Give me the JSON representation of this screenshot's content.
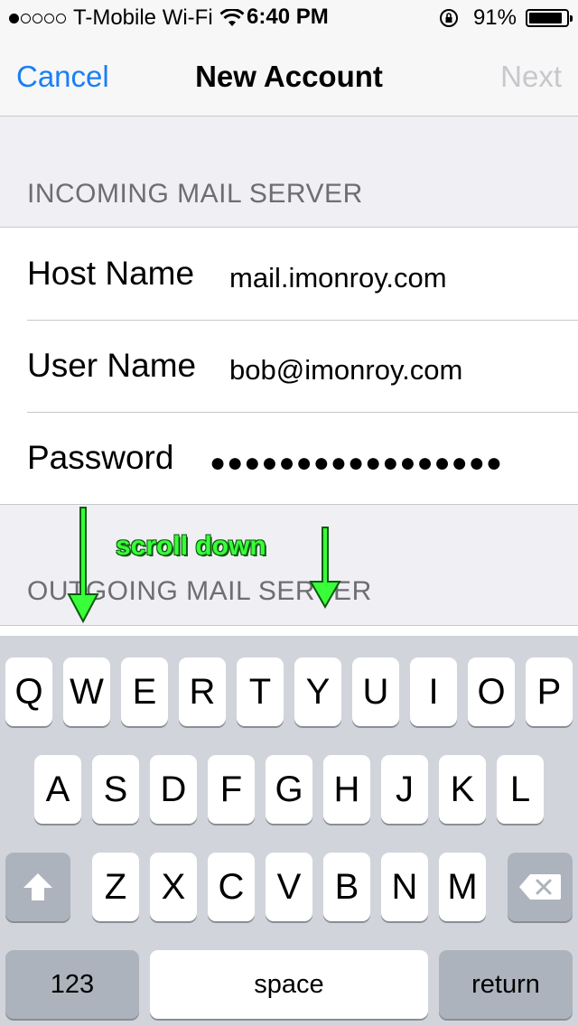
{
  "status_bar": {
    "signal_dots_filled": 1,
    "signal_dots_total": 5,
    "carrier": "T-Mobile Wi-Fi",
    "time": "6:40 PM",
    "battery_percent": "91%",
    "battery_level": 0.91
  },
  "nav": {
    "cancel_label": "Cancel",
    "title": "New Account",
    "next_label": "Next"
  },
  "incoming": {
    "header": "INCOMING MAIL SERVER",
    "rows": [
      {
        "label": "Host Name",
        "value": "mail.imonroy.com"
      },
      {
        "label": "User Name",
        "value": "bob@imonroy.com"
      },
      {
        "label": "Password",
        "value": "●●●●●●●●●●●●●●●●●"
      }
    ]
  },
  "outgoing": {
    "header": "OUTGOING MAIL SERVER"
  },
  "annotation": {
    "text": "scroll down",
    "color": "#39ff3a"
  },
  "keyboard": {
    "row1": [
      "Q",
      "W",
      "E",
      "R",
      "T",
      "Y",
      "U",
      "I",
      "O",
      "P"
    ],
    "row2": [
      "A",
      "S",
      "D",
      "F",
      "G",
      "H",
      "J",
      "K",
      "L"
    ],
    "row3": [
      "Z",
      "X",
      "C",
      "V",
      "B",
      "N",
      "M"
    ],
    "numbers_label": "123",
    "space_label": "space",
    "return_label": "return",
    "shift_icon": "shift-arrow-icon",
    "delete_icon": "backspace-icon"
  },
  "colors": {
    "accent": "#1a7ff5",
    "disabled": "#c7c7cc",
    "background": "#efeff4"
  }
}
